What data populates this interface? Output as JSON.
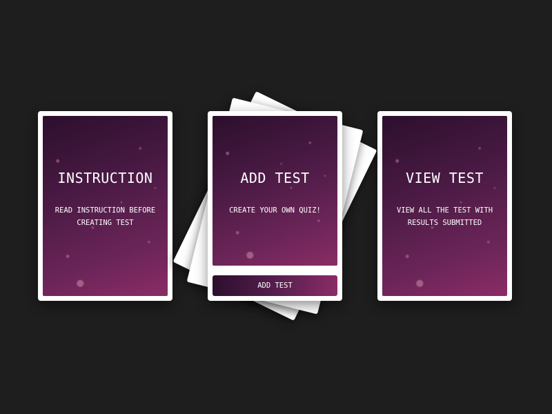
{
  "cards": [
    {
      "title": "INSTRUCTION",
      "description": "READ INSTRUCTION BEFORE CREATING TEST"
    },
    {
      "title": "ADD TEST",
      "description": "CREATE YOUR OWN QUIZ!",
      "button_label": "ADD TEST"
    },
    {
      "title": "VIEW TEST",
      "description": "VIEW ALL THE TEST WITH RESULTS SUBMITTED"
    }
  ],
  "colors": {
    "page_background": "#1e1e1e",
    "card_frame": "#ffffff",
    "panel_dark": "#2c0f2d",
    "panel_light": "#8a2c66"
  }
}
